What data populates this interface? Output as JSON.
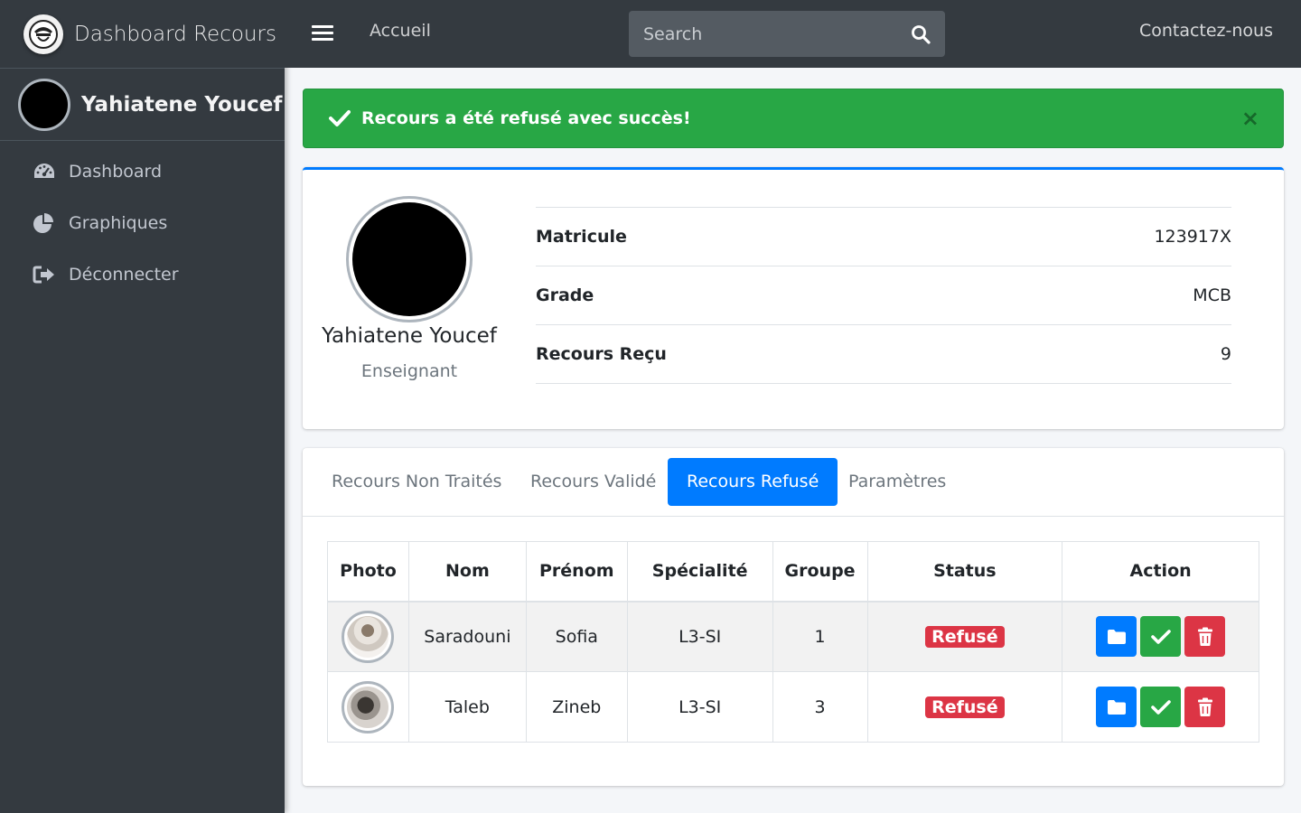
{
  "brand": {
    "title": "Dashboard Recours"
  },
  "user": {
    "name": "Yahiatene Youcef"
  },
  "sidebar": {
    "items": [
      {
        "label": "Dashboard",
        "icon": "tachometer-icon"
      },
      {
        "label": "Graphiques",
        "icon": "pie-chart-icon"
      },
      {
        "label": "Déconnecter",
        "icon": "sign-out-icon"
      }
    ]
  },
  "topbar": {
    "home_label": "Accueil",
    "search_placeholder": "Search",
    "contact_label": "Contactez-nous"
  },
  "alert": {
    "message": "Recours a été refusé avec succès!",
    "close": "×",
    "color": "#28a745"
  },
  "profile": {
    "name": "Yahiatene Youcef",
    "role": "Enseignant",
    "info": [
      {
        "key": "Matricule",
        "value": "123917X"
      },
      {
        "key": "Grade",
        "value": "MCB"
      },
      {
        "key": "Recours Reçu",
        "value": "9"
      }
    ]
  },
  "tabs": [
    {
      "label": "Recours Non Traités",
      "active": false
    },
    {
      "label": "Recours Validé",
      "active": false
    },
    {
      "label": "Recours Refusé",
      "active": true
    },
    {
      "label": "Paramètres",
      "active": false
    }
  ],
  "table": {
    "headers": [
      "Photo",
      "Nom",
      "Prénom",
      "Spécialité",
      "Groupe",
      "Status",
      "Action"
    ],
    "rows": [
      {
        "nom": "Saradouni",
        "prenom": "Sofia",
        "specialite": "L3-SI",
        "groupe": "1",
        "status": "Refusé"
      },
      {
        "nom": "Taleb",
        "prenom": "Zineb",
        "specialite": "L3-SI",
        "groupe": "3",
        "status": "Refusé"
      }
    ]
  },
  "colors": {
    "sidebar": "#343a40",
    "primary": "#007bff",
    "success": "#28a745",
    "danger": "#dc3545"
  }
}
